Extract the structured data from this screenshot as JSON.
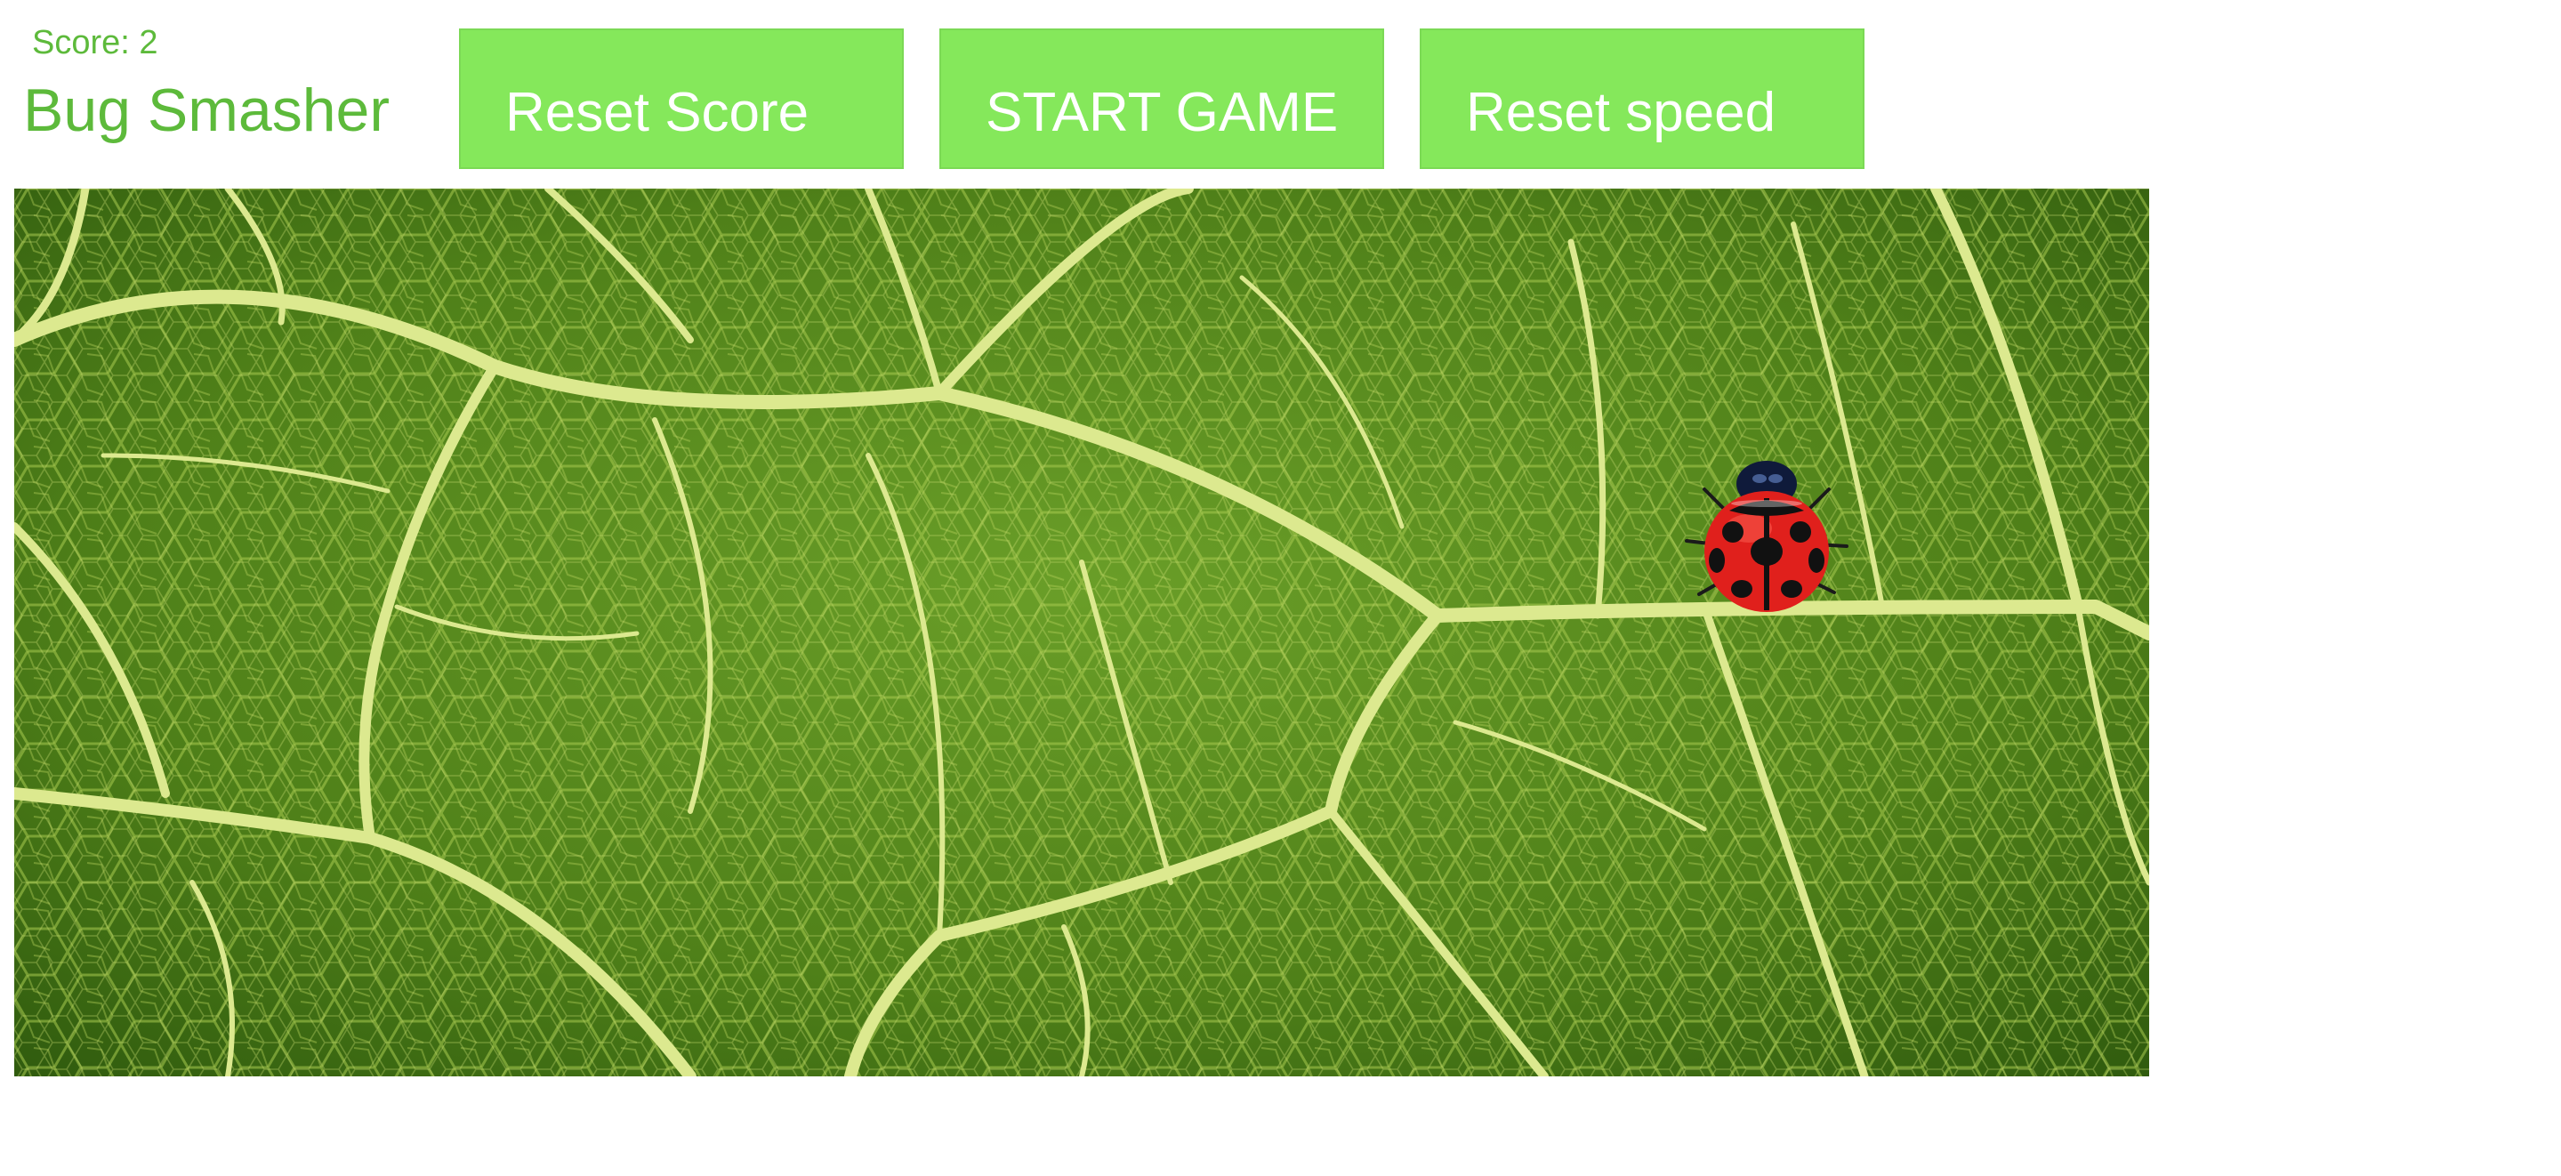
{
  "game": {
    "title": "Bug Smasher",
    "score_label": "Score: 2"
  },
  "buttons": {
    "reset_score": "Reset Score",
    "start_game": "START GAME",
    "reset_speed": "Reset speed"
  },
  "colors": {
    "text_green": "#5dba3b",
    "button_green": "#85e85b",
    "leaf_dark": "#3d6a12",
    "leaf_mid": "#5c8f22",
    "vein": "#d9e88a",
    "ladybug_red": "#e0201c",
    "ladybug_black": "#111111"
  },
  "icons": {
    "bug": "ladybug-icon"
  }
}
